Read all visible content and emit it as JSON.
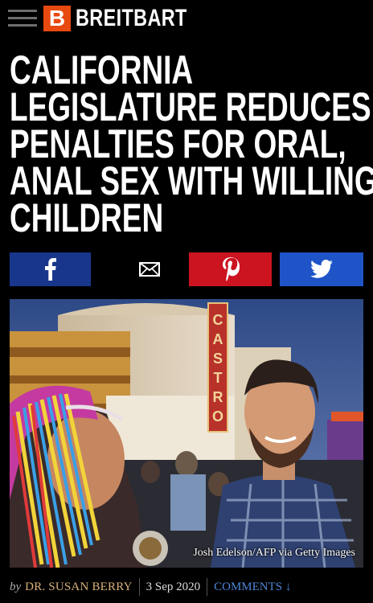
{
  "header": {
    "brand_mark": "B",
    "brand_name": "BREITBART",
    "brand_color": "#e8490f"
  },
  "article": {
    "headline_lines": [
      "CALIFORNIA",
      "LEGISLATURE REDUCES",
      "PENALTIES FOR ORAL,",
      "ANAL SEX WITH WILLING",
      "CHILDREN"
    ],
    "photo_credit": "Josh Edelson/AFP via Getty Images",
    "byline": {
      "by": "by",
      "author": "DR. SUSAN BERRY",
      "date": "3 Sep 2020",
      "comments": "COMMENTS ↓"
    }
  },
  "share_buttons": [
    {
      "network": "facebook",
      "icon": "facebook-icon",
      "color": "#18378c"
    },
    {
      "network": "email",
      "icon": "envelope-icon",
      "color": "#000000"
    },
    {
      "network": "pinterest",
      "icon": "pinterest-icon",
      "color": "#cc1320"
    },
    {
      "network": "twitter",
      "icon": "twitter-bird-icon",
      "color": "#1e54c7"
    }
  ],
  "photo": {
    "sign_letters": "CASTRO"
  }
}
